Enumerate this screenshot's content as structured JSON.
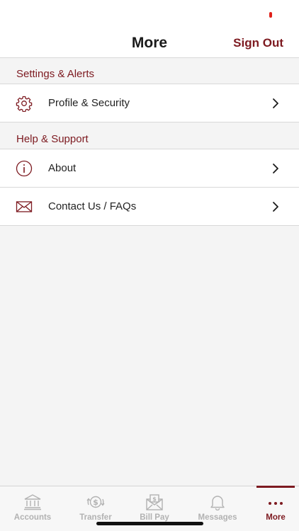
{
  "header": {
    "title": "More",
    "sign_out_label": "Sign Out"
  },
  "sections": [
    {
      "title": "Settings & Alerts",
      "items": [
        {
          "label": "Profile & Security",
          "icon": "gear-icon"
        }
      ]
    },
    {
      "title": "Help & Support",
      "items": [
        {
          "label": "About",
          "icon": "info-icon"
        },
        {
          "label": "Contact Us / FAQs",
          "icon": "envelope-icon"
        }
      ]
    }
  ],
  "tabbar": {
    "active": "More",
    "tabs": [
      {
        "label": "Accounts",
        "icon": "bank-icon"
      },
      {
        "label": "Transfer",
        "icon": "transfer-icon"
      },
      {
        "label": "Bill Pay",
        "icon": "bill-pay-icon"
      },
      {
        "label": "Messages",
        "icon": "bell-icon"
      },
      {
        "label": "More",
        "icon": "more-dots-icon"
      }
    ]
  },
  "colors": {
    "accent": "#7d1a20",
    "inactive_tab": "#b2b2b2",
    "background": "#f4f4f4"
  }
}
